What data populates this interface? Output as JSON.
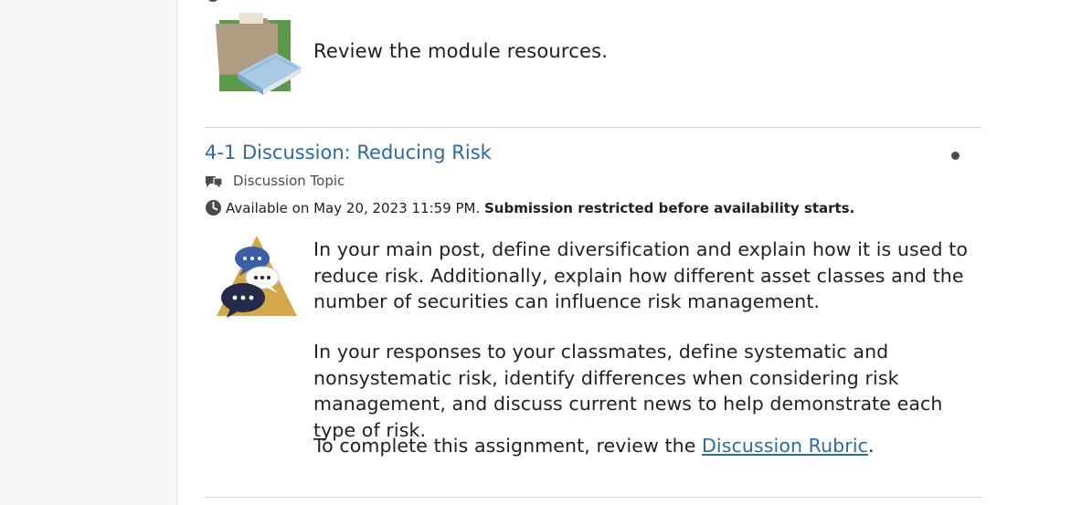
{
  "resources": {
    "text": "Review the module resources."
  },
  "item": {
    "title": "4-1 Discussion: Reducing Risk",
    "type_label": "Discussion Topic",
    "availability_text": "Available on May 20, 2023 11:59 PM.",
    "availability_restriction": "Submission restricted before availability starts."
  },
  "content": {
    "paragraph1": "In your main post, define diversification and explain how it is used to reduce risk. Additionally, explain how different asset classes and the number of securities can influence risk management.",
    "paragraph2": "In your responses to your classmates, define systematic and nonsystematic risk, identify differences when considering risk management, and discuss current news to help demonstrate each type of risk.",
    "paragraph3_prefix": "To complete this assignment, review the ",
    "paragraph3_link": "Discussion Rubric",
    "paragraph3_suffix": "."
  },
  "icons": {
    "resources": "folder-book-icon",
    "type": "discussion-topic-icon",
    "availability": "clock-icon",
    "discussion": "discussion-bubbles-icon",
    "status": "status-dot-icon"
  },
  "colors": {
    "link": "#2d6aa3",
    "text": "#202122",
    "muted": "#494c4e",
    "divider": "#d3d9e3",
    "rail": "#f6f7f9"
  }
}
